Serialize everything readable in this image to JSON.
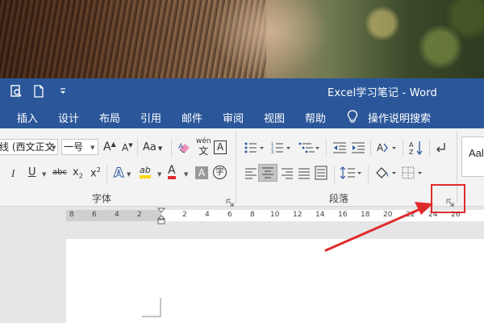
{
  "window": {
    "title": "Excel学习笔记  -  Word",
    "quick_access": [
      "print-preview-icon",
      "new-document-icon",
      "customize-more-icon"
    ]
  },
  "tabs": [
    {
      "label": "插入"
    },
    {
      "label": "设计"
    },
    {
      "label": "布局"
    },
    {
      "label": "引用"
    },
    {
      "label": "邮件"
    },
    {
      "label": "审阅"
    },
    {
      "label": "视图"
    },
    {
      "label": "帮助"
    }
  ],
  "tell_me": {
    "label": "操作说明搜索",
    "icon": "lightbulb-icon"
  },
  "ribbon": {
    "font": {
      "name_value": "线 (西文正文",
      "size_value": "一号",
      "grow_label": "A",
      "shrink_label": "A",
      "case_label": "Aa",
      "clear_format_icon": "eraser-icon",
      "phonetic_top": "wén",
      "phonetic_bottom": "文",
      "border_char_label": "A",
      "italic_label": "I",
      "underline_label": "U",
      "strike_label": "abc",
      "subscript_label": "x",
      "subscript_suffix": "2",
      "superscript_label": "x",
      "superscript_suffix": "2",
      "text_effect_label": "A",
      "highlight_label": "ab",
      "font_color_label": "A",
      "char_shading_label": "A",
      "enclose_char_label": "字",
      "group_label": "字体"
    },
    "paragraph": {
      "group_label": "段落"
    },
    "styles": {
      "preview_label": "Aal"
    },
    "colors": {
      "highlight": "#ffd800",
      "font_color": "#e02b2b",
      "accent": "#2b579a"
    }
  },
  "ruler": {
    "ticks": [
      "8",
      "6",
      "4",
      "2",
      "2",
      "4",
      "6",
      "8",
      "10",
      "12",
      "14",
      "16",
      "18",
      "20",
      "22",
      "24",
      "26"
    ]
  },
  "annotation": {
    "color": "#e02b2b"
  }
}
